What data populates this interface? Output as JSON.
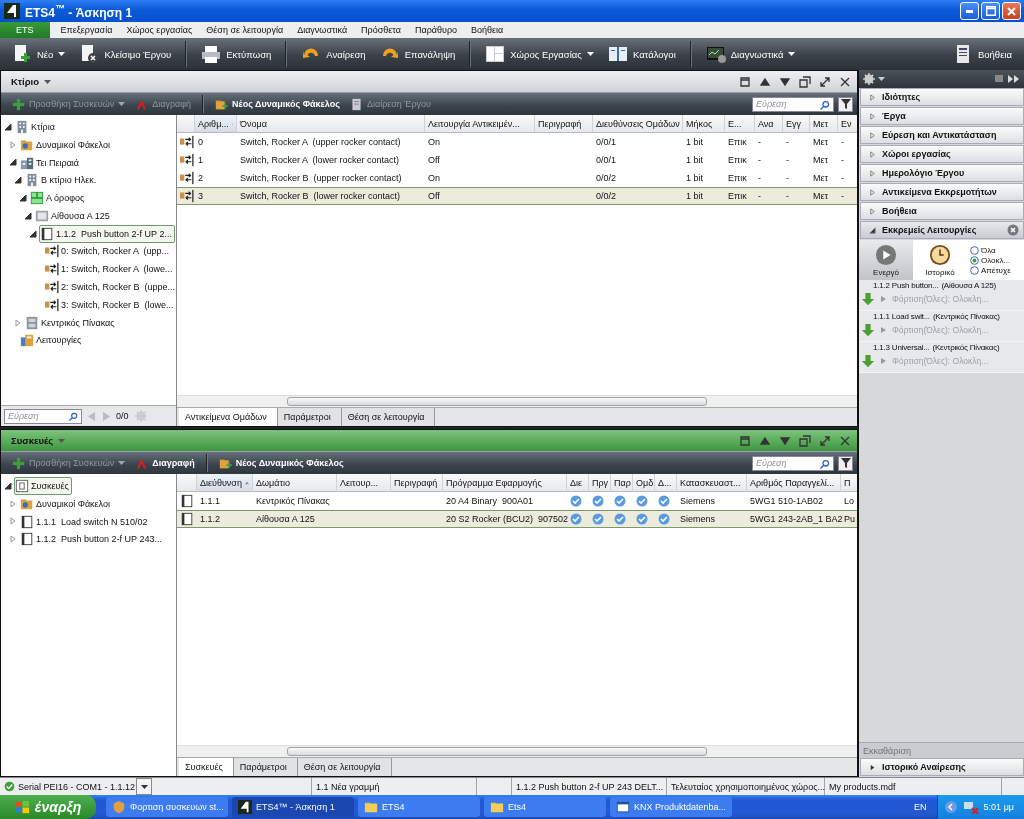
{
  "window": {
    "title": "ETS4$^{™}$ - Άσκηση 1"
  },
  "menu": [
    {
      "label": "ETS",
      "kind": "app"
    },
    {
      "label": "Επεξεργασία",
      "kind": "menu"
    },
    {
      "label": "Χώρος εργασίας",
      "kind": "menu"
    },
    {
      "label": "Θέση σε λειτουργία",
      "kind": "menu"
    },
    {
      "label": "Διαγνωστικά",
      "kind": "menu"
    },
    {
      "label": "Πρόσθετα",
      "kind": "menu"
    },
    {
      "label": "Παράθυρο",
      "kind": "menu"
    },
    {
      "label": "Βοήθεια",
      "kind": "menu"
    }
  ],
  "toolbar_groups": [
    [
      {
        "label": "Νέο",
        "kind": "new",
        "dropdown": true
      },
      {
        "label": "Κλείσιμο Έργου",
        "kind": "close",
        "dropdown": false
      }
    ],
    [
      {
        "label": "Εκτύπωση",
        "kind": "print",
        "dropdown": false
      }
    ],
    [
      {
        "label": "Αναίρεση",
        "kind": "undo",
        "dropdown": false
      },
      {
        "label": "Επανάληψη",
        "kind": "redo",
        "dropdown": false
      }
    ],
    [
      {
        "label": "Χώρος Εργασίας",
        "kind": "workspace",
        "dropdown": true
      },
      {
        "label": "Κατάλογοι",
        "kind": "catalog",
        "dropdown": false
      }
    ],
    [
      {
        "label": "Διαγνωστικά",
        "kind": "diagnostics",
        "dropdown": true
      }
    ]
  ],
  "help_button": {
    "label": "Βοήθεια"
  },
  "panels": [
    {
      "title": "Κτίριο",
      "active": false,
      "actions": [
        {
          "label": "Προσθήκη Συσκευών",
          "kind": "add",
          "dropdown": true,
          "disabled": true
        },
        {
          "label": "Διαγραφή",
          "kind": "delete",
          "dropdown": false,
          "disabled": true
        },
        {
          "label": "Νέος Δυναμικός Φάκελος",
          "kind": "folder",
          "dropdown": false,
          "disabled": false
        },
        {
          "label": "Διαίρεση Έργου",
          "kind": "split",
          "dropdown": false,
          "disabled": true
        }
      ],
      "search": {
        "placeholder": "Εύρεση"
      },
      "tree": [
        {
          "label": "Κτίρια",
          "kind": "building",
          "expanded": true,
          "selected": false,
          "children": [
            {
              "label": "Δυναμικοί Φάκελοι",
              "kind": "dynfolder",
              "expanded": false,
              "selected": false
            },
            {
              "label": "Τει Πειραιά",
              "kind": "site",
              "expanded": true,
              "selected": false,
              "children": [
                {
                  "label": "Β κτίριο Ηλεκ.",
                  "kind": "building",
                  "expanded": true,
                  "selected": false,
                  "children": [
                    {
                      "label": "Α όροφος",
                      "kind": "floor",
                      "expanded": true,
                      "selected": false,
                      "children": [
                        {
                          "label": "Αίθουσα Α 125",
                          "kind": "room",
                          "expanded": true,
                          "selected": false,
                          "children": [
                            {
                              "label": "1.1.2  Push button 2-f UP 2...",
                              "kind": "device",
                              "expanded": true,
                              "selected": true,
                              "children": [
                                {
                                  "label": "0: Switch, Rocker A  (upp...",
                                  "kind": "object",
                                  "selected": false
                                },
                                {
                                  "label": "1: Switch, Rocker A  (lowe...",
                                  "kind": "object",
                                  "selected": false
                                },
                                {
                                  "label": "2: Switch, Rocker B  (uppe...",
                                  "kind": "object",
                                  "selected": false
                                },
                                {
                                  "label": "3: Switch, Rocker B  (lowe...",
                                  "kind": "object",
                                  "selected": false
                                }
                              ]
                            }
                          ]
                        }
                      ]
                    }
                  ]
                },
                {
                  "label": "Κεντρικός Πίνακας",
                  "kind": "cabinet",
                  "expanded": false,
                  "selected": false
                }
              ]
            },
            {
              "label": "Λειτουργίες",
              "kind": "functions",
              "selected": false
            }
          ]
        }
      ],
      "pager": {
        "search": {
          "placeholder": "Εύρεση"
        },
        "count": "0/0"
      },
      "columns": [
        {
          "label": "Αριθμ...",
          "kind": "text",
          "sorted": true
        },
        {
          "label": "Όνομα",
          "kind": "text",
          "sorted": false
        },
        {
          "label": "Λειτουργία Αντικειμέν...",
          "kind": "text",
          "sorted": false
        },
        {
          "label": "Περιγραφή",
          "kind": "text",
          "sorted": false
        },
        {
          "label": "Διευθύνσεις Ομάδων",
          "kind": "text",
          "sorted": false
        },
        {
          "label": "Μήκος",
          "kind": "text",
          "sorted": false
        },
        {
          "label": "Ε...",
          "kind": "text",
          "sorted": false
        },
        {
          "label": "Ανα",
          "kind": "text",
          "sorted": false
        },
        {
          "label": "Εγγ",
          "kind": "text",
          "sorted": false
        },
        {
          "label": "Μετ",
          "kind": "text",
          "sorted": false
        },
        {
          "label": "Εν",
          "kind": "text",
          "sorted": false
        }
      ],
      "rows": [
        {
          "kind": "object",
          "selected": false,
          "cells": [
            "0",
            "Switch, Rocker A  (upper rocker contact)",
            "On",
            "",
            "0/0/1",
            "1 bit",
            "Επικ",
            "-",
            "-",
            "Μετ",
            "-"
          ]
        },
        {
          "kind": "object",
          "selected": false,
          "cells": [
            "1",
            "Switch, Rocker A  (lower rocker contact)",
            "Off",
            "",
            "0/0/1",
            "1 bit",
            "Επικ",
            "-",
            "-",
            "Μετ",
            "-"
          ]
        },
        {
          "kind": "object",
          "selected": false,
          "cells": [
            "2",
            "Switch, Rocker B  (upper rocker contact)",
            "On",
            "",
            "0/0/2",
            "1 bit",
            "Επικ",
            "-",
            "-",
            "Μετ",
            "-"
          ]
        },
        {
          "kind": "object",
          "selected": true,
          "cells": [
            "3",
            "Switch, Rocker B  (lower rocker contact)",
            "Off",
            "",
            "0/0/2",
            "1 bit",
            "Επικ",
            "-",
            "-",
            "Μετ",
            "-"
          ]
        }
      ],
      "tabs": [
        {
          "label": "Αντικείμενα Ομάδων",
          "selected": true
        },
        {
          "label": "Παράμετροι",
          "selected": false
        },
        {
          "label": "Θέση σε λειτουργία",
          "selected": false
        }
      ]
    },
    {
      "title": "Συσκευές",
      "active": true,
      "actions": [
        {
          "label": "Προσθήκη Συσκευών",
          "kind": "add",
          "dropdown": true,
          "disabled": true
        },
        {
          "label": "Διαγραφή",
          "kind": "delete",
          "dropdown": false,
          "disabled": false
        },
        {
          "label": "Νέος Δυναμικός Φάκελος",
          "kind": "folder",
          "dropdown": false,
          "disabled": false
        }
      ],
      "search": {
        "placeholder": "Εύρεση"
      },
      "tree": [
        {
          "label": "Συσκευές",
          "kind": "devlist",
          "expanded": true,
          "selected": true,
          "children": [
            {
              "label": "Δυναμικοί Φάκελοι",
              "kind": "dynfolder",
              "expanded": false,
              "selected": false
            },
            {
              "label": "1.1.1  Load switch N 510/02",
              "kind": "device",
              "expanded": false,
              "selected": false
            },
            {
              "label": "1.1.2  Push button 2-f UP 243...",
              "kind": "device",
              "expanded": false,
              "selected": false
            }
          ]
        }
      ],
      "columns": [
        {
          "label": "Διεύθυνση",
          "kind": "text",
          "sorted": true
        },
        {
          "label": "Δωμάτιο",
          "kind": "text",
          "sorted": false
        },
        {
          "label": "Λειτουρ...",
          "kind": "text",
          "sorted": false
        },
        {
          "label": "Περιγραφή",
          "kind": "text",
          "sorted": false
        },
        {
          "label": "Πρόγραμμα Εφαρμογής",
          "kind": "text",
          "sorted": false
        },
        {
          "label": "Διε",
          "kind": "check",
          "sorted": false
        },
        {
          "label": "Πργ",
          "kind": "check",
          "sorted": false
        },
        {
          "label": "Παρ",
          "kind": "check",
          "sorted": false
        },
        {
          "label": "Ομδ",
          "kind": "check",
          "sorted": false
        },
        {
          "label": "Δ...",
          "kind": "check",
          "sorted": false
        },
        {
          "label": "Κατασκευαστ...",
          "kind": "text",
          "sorted": false
        },
        {
          "label": "Αριθμός Παραγγελί...",
          "kind": "text",
          "sorted": false
        },
        {
          "label": "Π",
          "kind": "text",
          "sorted": false
        }
      ],
      "rows": [
        {
          "kind": "device",
          "selected": false,
          "cells": [
            "1.1.1",
            "Κεντρικός Πίνακας",
            "",
            "",
            "20 A4 Binary  900A01",
            true,
            true,
            true,
            true,
            true,
            "Siemens",
            "5WG1 510-1AB02",
            "Lo"
          ]
        },
        {
          "kind": "device",
          "selected": true,
          "cells": [
            "1.1.2",
            "Αίθουσα Α 125",
            "",
            "",
            "20 S2 Rocker (BCU2)  907502",
            true,
            true,
            true,
            true,
            true,
            "Siemens",
            "5WG1 243-2AB_1 BA2",
            "Pu"
          ]
        }
      ],
      "tabs": [
        {
          "label": "Συσκευές",
          "selected": true
        },
        {
          "label": "Παράμετροι",
          "selected": false
        },
        {
          "label": "Θέση σε λειτουργία",
          "selected": false
        }
      ]
    }
  ],
  "side": {
    "sections": [
      {
        "label": "Ιδιότητες",
        "expanded": false
      },
      {
        "label": "Έργα",
        "expanded": false
      },
      {
        "label": "Εύρεση και Αντικατάσταση",
        "expanded": false
      },
      {
        "label": "Χώροι εργασίας",
        "expanded": false
      },
      {
        "label": "Ημερολόγιο Έργου",
        "expanded": false
      },
      {
        "label": "Αντικείμενα Εκκρεμοτήτων",
        "expanded": false
      },
      {
        "label": "Βοήθεια",
        "expanded": false
      },
      {
        "label": "Εκκρεμείς Λειτουργίες",
        "expanded": true,
        "content": {
          "modes": [
            {
              "label": "Ενεργό",
              "kind": "play",
              "selected": false
            },
            {
              "label": "Ιστορικό",
              "kind": "clock",
              "selected": true
            }
          ],
          "filters": [
            {
              "label": "Όλα",
              "selected": false
            },
            {
              "label": "Ολοκλ...",
              "selected": true
            },
            {
              "label": "Απέτυχε",
              "selected": false
            }
          ],
          "operations": [
            {
              "device": "1.1.2 Push button...",
              "location": "(Αίθουσα Α 125)",
              "detail": "Φόρτιση(Όλες): Ολοκλη..."
            },
            {
              "device": "1.1.1 Load swit...",
              "location": "(Κεντρικός Πίνακας)",
              "detail": "Φόρτιση(Όλες): Ολοκλη..."
            },
            {
              "device": "1.1.3 Universal...",
              "location": "(Κεντρικός Πίνακας)",
              "detail": "Φόρτιση(Όλες): Ολοκλη..."
            }
          ]
        }
      }
    ],
    "clear_button": {
      "label": "Εκκαθάριση",
      "disabled": true
    },
    "footer_sections": [
      {
        "label": "Ιστορικό Αναίρεσης",
        "expanded": false
      }
    ]
  },
  "status_bar": {
    "connection": "Serial PEI16 - COM1 - 1.1.12",
    "fields": [
      "1.1 Νέα γραμμή",
      "1.1.2  Push button 2-f UP 243 DELT...",
      "Τελευταίος χρησιμοποιημένος χώρος...",
      "My products.mdf"
    ]
  },
  "taskbar": {
    "start": "έναρξη",
    "tasks": [
      {
        "label": "Φορτιση συσκευων st...",
        "kind": "tool",
        "selected": false
      },
      {
        "label": "ETS4™ - Άσκηση 1",
        "kind": "ets",
        "selected": true
      },
      {
        "label": "ETS4",
        "kind": "folder",
        "selected": false
      },
      {
        "label": "Ets4",
        "kind": "folder",
        "selected": false
      },
      {
        "label": "KNX Produktdatenba...",
        "kind": "knx",
        "selected": false
      }
    ],
    "language": "EN",
    "clock": "5:01 μμ"
  }
}
